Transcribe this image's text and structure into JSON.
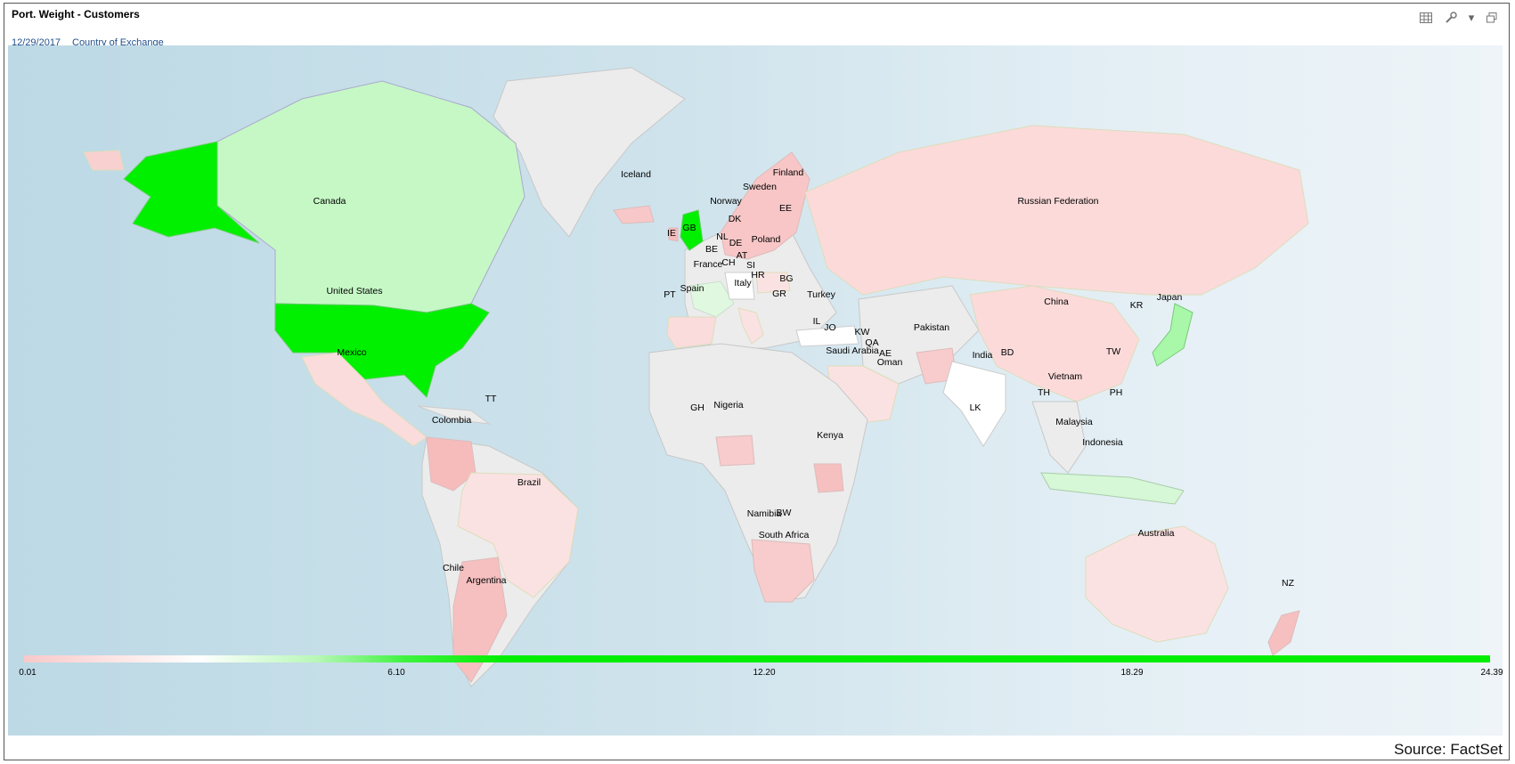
{
  "header": {
    "title": "Port. Weight - Customers",
    "date": "12/29/2017",
    "grouping": "Country of Exchange"
  },
  "toolbar": {
    "grid_icon": "grid-icon",
    "wrench_icon": "wrench-icon",
    "dropdown_icon": "caret-down-icon",
    "restore_icon": "window-restore-icon"
  },
  "colors": {
    "ocean": "#c7dfe9",
    "no_data": "#ececec",
    "low": "#f8cccc",
    "mid": "#ffffff",
    "high": "#00ee00"
  },
  "legend": {
    "ticks": [
      "0.01",
      "6.10",
      "12.20",
      "18.29",
      "24.39"
    ]
  },
  "labels": [
    "Canada",
    "United States",
    "Mexico",
    "Colombia",
    "TT",
    "Brazil",
    "Chile",
    "Argentina",
    "Iceland",
    "GB",
    "IE",
    "Norway",
    "Sweden",
    "Finland",
    "EE",
    "DK",
    "NL",
    "BE",
    "DE",
    "Poland",
    "France",
    "CH",
    "AT",
    "SI",
    "HR",
    "BG",
    "Italy",
    "Spain",
    "PT",
    "GR",
    "Turkey",
    "IL",
    "JO",
    "KW",
    "QA",
    "Saudi Arabia",
    "AE",
    "Oman",
    "Pakistan",
    "India",
    "BD",
    "LK",
    "Russian Federation",
    "China",
    "KR",
    "Japan",
    "TW",
    "Vietnam",
    "TH",
    "PH",
    "Malaysia",
    "Indonesia",
    "GH",
    "Nigeria",
    "Kenya",
    "Namibia",
    "BW",
    "South Africa",
    "Australia",
    "NZ"
  ],
  "source": "Source: FactSet"
}
